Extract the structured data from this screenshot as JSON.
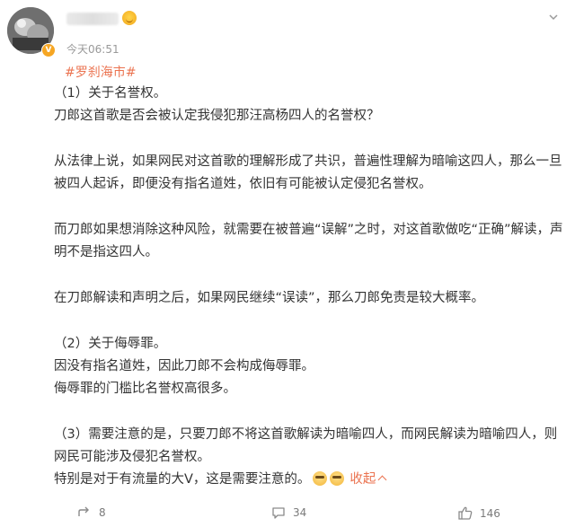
{
  "post": {
    "time": "今天06:51",
    "topic": "#罗刹海市#",
    "paragraphs": {
      "p1": "（1）关于名誉权。",
      "p2": "刀郎这首歌是否会被认定我侵犯那汪高杨四人的名誉权？",
      "p3": "从法律上说，如果网民对这首歌的理解形成了共识，普遍性理解为暗喻这四人，那么一旦被四人起诉，即便没有指名道姓，依旧有可能被认定侵犯名誉权。",
      "p4": "而刀郎如果想消除这种风险，就需要在被普遍“误解”之时，对这首歌做吃“正确”解读，声明不是指这四人。",
      "p5": "在刀郎解读和声明之后，如果网民继续“误读”，那么刀郎免责是较大概率。",
      "p6": "（2）关于侮辱罪。",
      "p7": "因没有指名道姓，因此刀郎不会构成侮辱罪。",
      "p8": "侮辱罪的门槛比名誉权高很多。",
      "p9": "（3）需要注意的是，只要刀郎不将这首歌解读为暗喻四人，而网民解读为暗喻四人，则网民可能涉及侵犯名誉权。",
      "p10": "特别是对于有流量的大V，这是需要注意的。"
    },
    "collapse_label": "收起"
  },
  "actions": {
    "forward_count": "8",
    "comment_count": "34",
    "like_count": "146"
  },
  "colors": {
    "accent": "#eb7350",
    "text": "#333333",
    "muted": "#999999"
  },
  "icons": {
    "forward": "forward-icon",
    "comment": "comment-icon",
    "like": "thumbs-up-icon",
    "more": "chevron-down-icon"
  }
}
